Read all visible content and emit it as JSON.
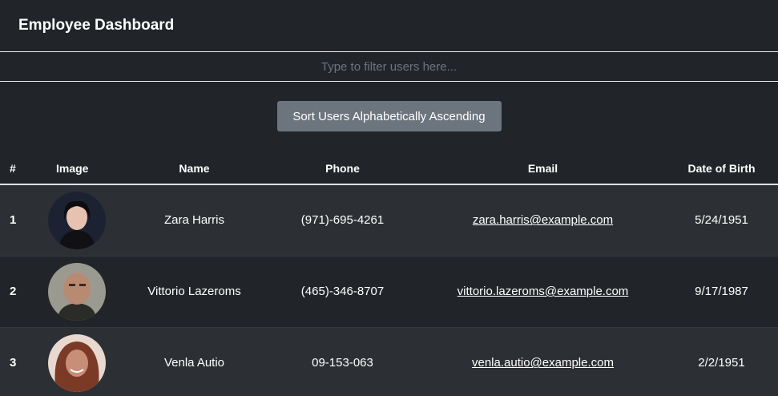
{
  "app": {
    "title": "Employee Dashboard"
  },
  "filter": {
    "placeholder": "Type to filter users here...",
    "value": ""
  },
  "sort_button": {
    "label": "Sort Users Alphabetically Ascending"
  },
  "table": {
    "headers": {
      "num": "#",
      "image": "Image",
      "name": "Name",
      "phone": "Phone",
      "email": "Email",
      "dob": "Date of Birth"
    },
    "rows": [
      {
        "num": "1",
        "name": "Zara Harris",
        "phone": "(971)-695-4261",
        "email": "zara.harris@example.com",
        "dob": "5/24/1951",
        "avatar_colors": [
          "#1d2233",
          "#e8c2b0",
          "#0d0d10"
        ]
      },
      {
        "num": "2",
        "name": "Vittorio Lazeroms",
        "phone": "(465)-346-8707",
        "email": "vittorio.lazeroms@example.com",
        "dob": "9/17/1987",
        "avatar_colors": [
          "#9a9a90",
          "#b88a72",
          "#2b2b28"
        ]
      },
      {
        "num": "3",
        "name": "Venla Autio",
        "phone": "09-153-063",
        "email": "venla.autio@example.com",
        "dob": "2/2/1951",
        "avatar_colors": [
          "#e9d8cf",
          "#c98e78",
          "#7a3a25"
        ]
      }
    ]
  },
  "colors": {
    "background": "#212529",
    "stripe": "#2c3034",
    "button": "#6c757d",
    "text": "#ffffff"
  }
}
